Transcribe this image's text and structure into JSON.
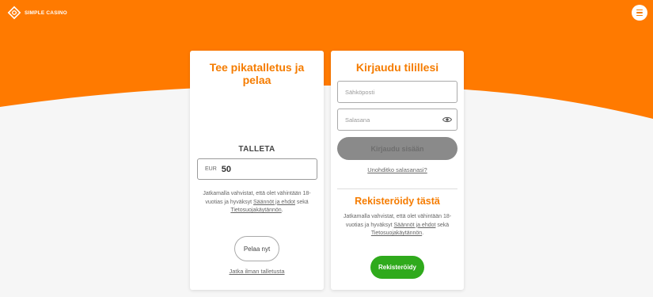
{
  "colors": {
    "brand": "#ff7a00",
    "accent_text": "#f57c00",
    "register": "#2faa1c",
    "login_disabled": "#8a8a8a"
  },
  "header": {
    "logo_text": "SIMPLE CASINO",
    "menu_icon": "hamburger-icon"
  },
  "deposit": {
    "title": "Tee pikatalletus ja pelaa",
    "label": "TALLETA",
    "currency": "EUR",
    "amount": "50",
    "terms_prefix": "Jatkamalla vahvistat, että olet vähintään 18-vuotias ja hyväksyt ",
    "terms_link": "Säännöt ja ehdot",
    "terms_mid": " sekä ",
    "privacy_link": "Tietosuojakäytännön",
    "terms_suffix": ".",
    "play_button": "Pelaa nyt",
    "no_deposit_link": "Jatka ilman talletusta"
  },
  "login": {
    "title": "Kirjaudu tilillesi",
    "email_placeholder": "Sähköposti",
    "password_placeholder": "Salasana",
    "login_button": "Kirjaudu sisään",
    "forgot_link": "Unohditko salasanasi?",
    "register_title": "Rekisteröidy tästä",
    "terms_prefix": "Jatkamalla vahvistat, että olet vähintään 18-vuotias ja hyväksyt ",
    "terms_link": "Säännöt ja ehdot",
    "terms_mid": " sekä ",
    "privacy_link": "Tietosuojakäytännön",
    "terms_suffix": ".",
    "register_button": "Rekisteröidy"
  }
}
